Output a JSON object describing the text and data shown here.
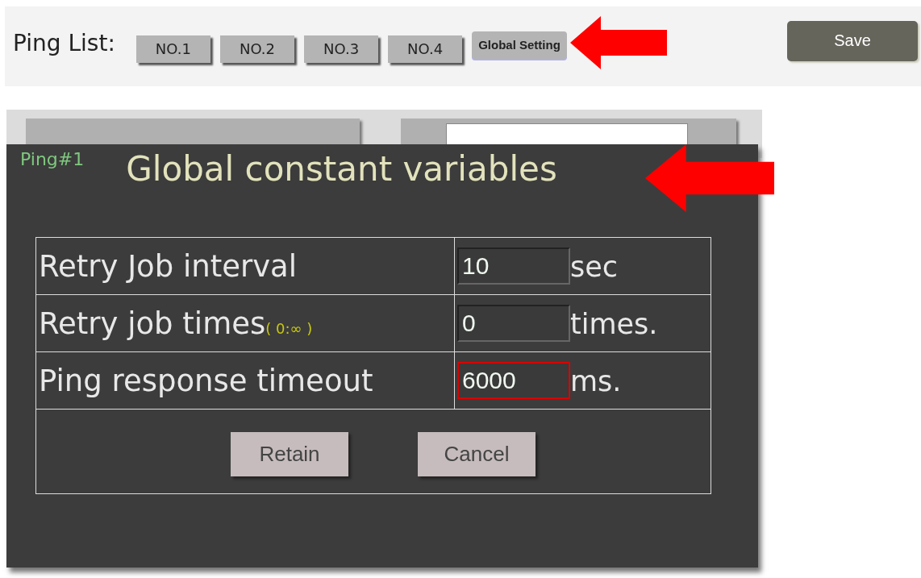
{
  "toolbar": {
    "label": "Ping List:",
    "tabs": [
      {
        "label": "NO.1",
        "selected": false
      },
      {
        "label": "NO.2",
        "selected": false
      },
      {
        "label": "NO.3",
        "selected": false
      },
      {
        "label": "NO.4",
        "selected": false
      },
      {
        "label": "Global Setting",
        "selected": true
      }
    ],
    "save": "Save"
  },
  "dialog": {
    "tag": "Ping#1",
    "title": "Global constant variables",
    "rows": [
      {
        "label": "Retry Job interval",
        "value": "10",
        "unit": "sec",
        "invalid": false
      },
      {
        "label": "Retry job times",
        "hint": "( 0:∞ )",
        "value": "0",
        "unit": "times.",
        "invalid": false
      },
      {
        "label": "Ping response timeout",
        "value": "6000",
        "unit": "ms.",
        "invalid": true
      }
    ],
    "buttons": [
      "Retain",
      "Cancel"
    ]
  }
}
